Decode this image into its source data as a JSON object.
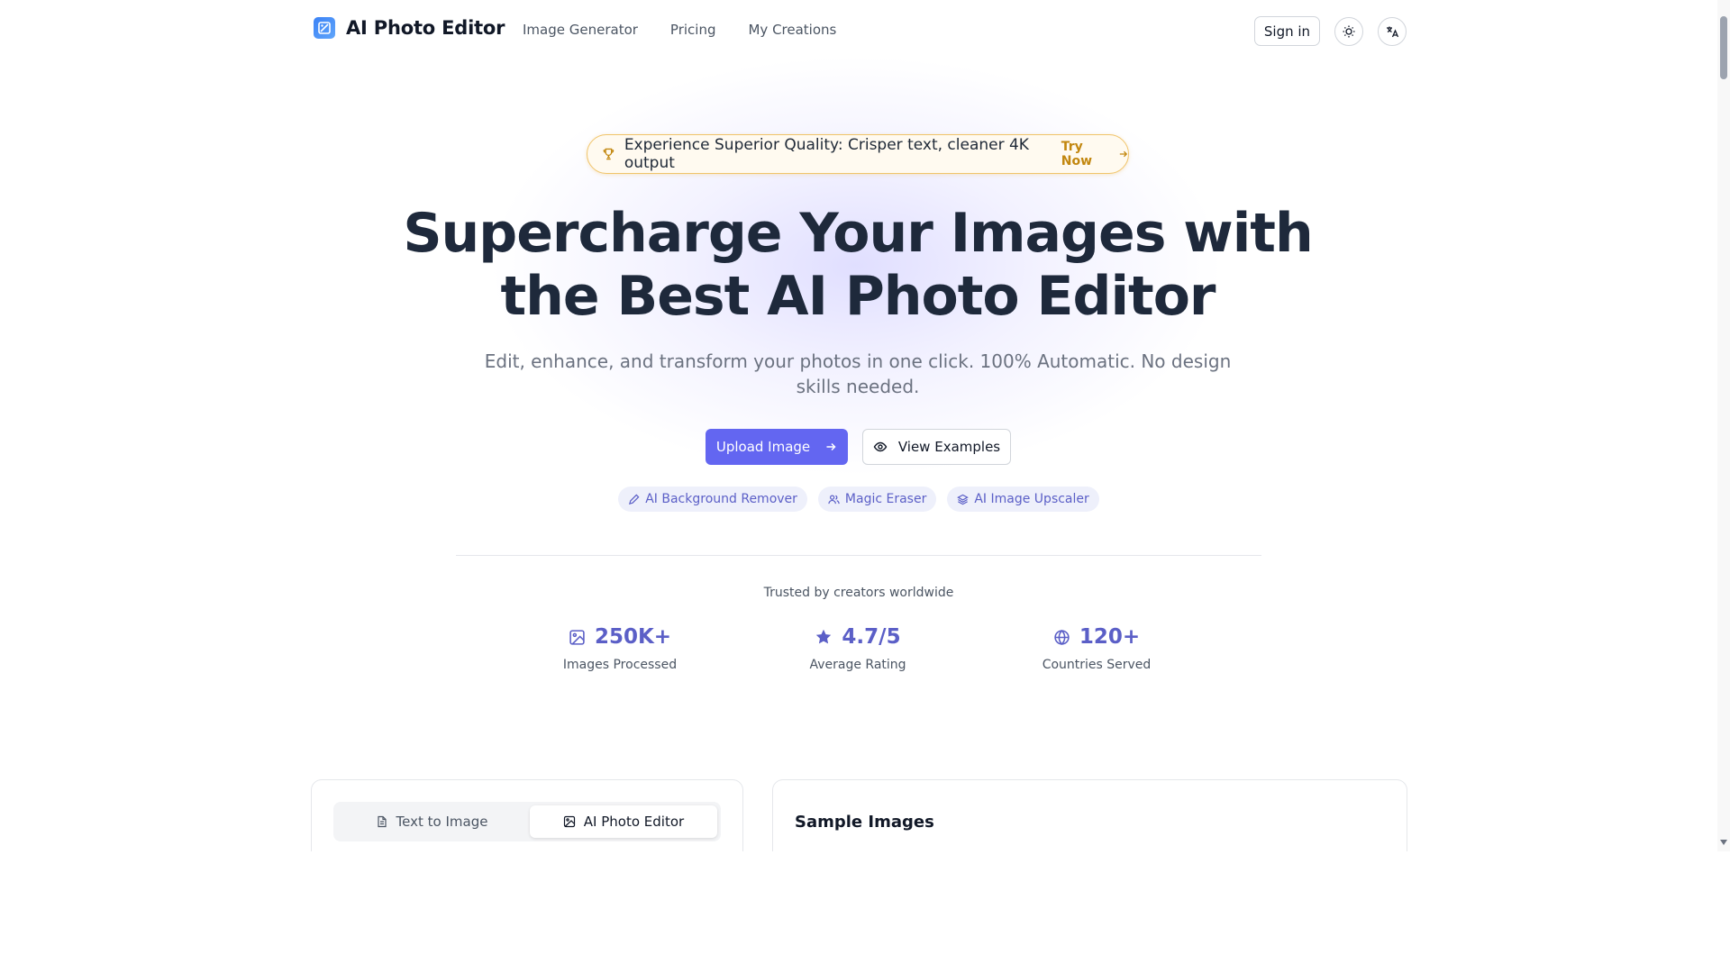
{
  "header": {
    "brand": "AI Photo Editor",
    "nav": [
      "Image Generator",
      "Pricing",
      "My Creations"
    ],
    "sign_in": "Sign in"
  },
  "announcement": {
    "text": "Experience Superior Quality: Crisper text, cleaner 4K output",
    "cta": "Try Now"
  },
  "hero": {
    "title_line1": "Supercharge Your Images with",
    "title_line2": "the Best AI Photo Editor",
    "subtitle": "Edit, enhance, and transform your photos in one click. 100% Automatic. No design skills needed.",
    "upload_button": "Upload Image",
    "examples_button": "View Examples"
  },
  "chips": [
    "AI Background Remover",
    "Magic Eraser",
    "AI Image Upscaler"
  ],
  "trust": {
    "heading": "Trusted by creators worldwide",
    "stats": [
      {
        "value": "250K+",
        "label": "Images Processed",
        "icon": "image-icon"
      },
      {
        "value": "4.7/5",
        "label": "Average Rating",
        "icon": "star-icon"
      },
      {
        "value": "120+",
        "label": "Countries Served",
        "icon": "globe-icon"
      }
    ]
  },
  "tool_panel": {
    "tabs": [
      "Text to Image",
      "AI Photo Editor"
    ],
    "active_tab": "AI Photo Editor"
  },
  "samples": {
    "title": "Sample Images"
  },
  "colors": {
    "accent": "#6366f1",
    "accent_text": "#5b5fc7",
    "gold": "#c2870f",
    "heading": "#1e293b"
  }
}
